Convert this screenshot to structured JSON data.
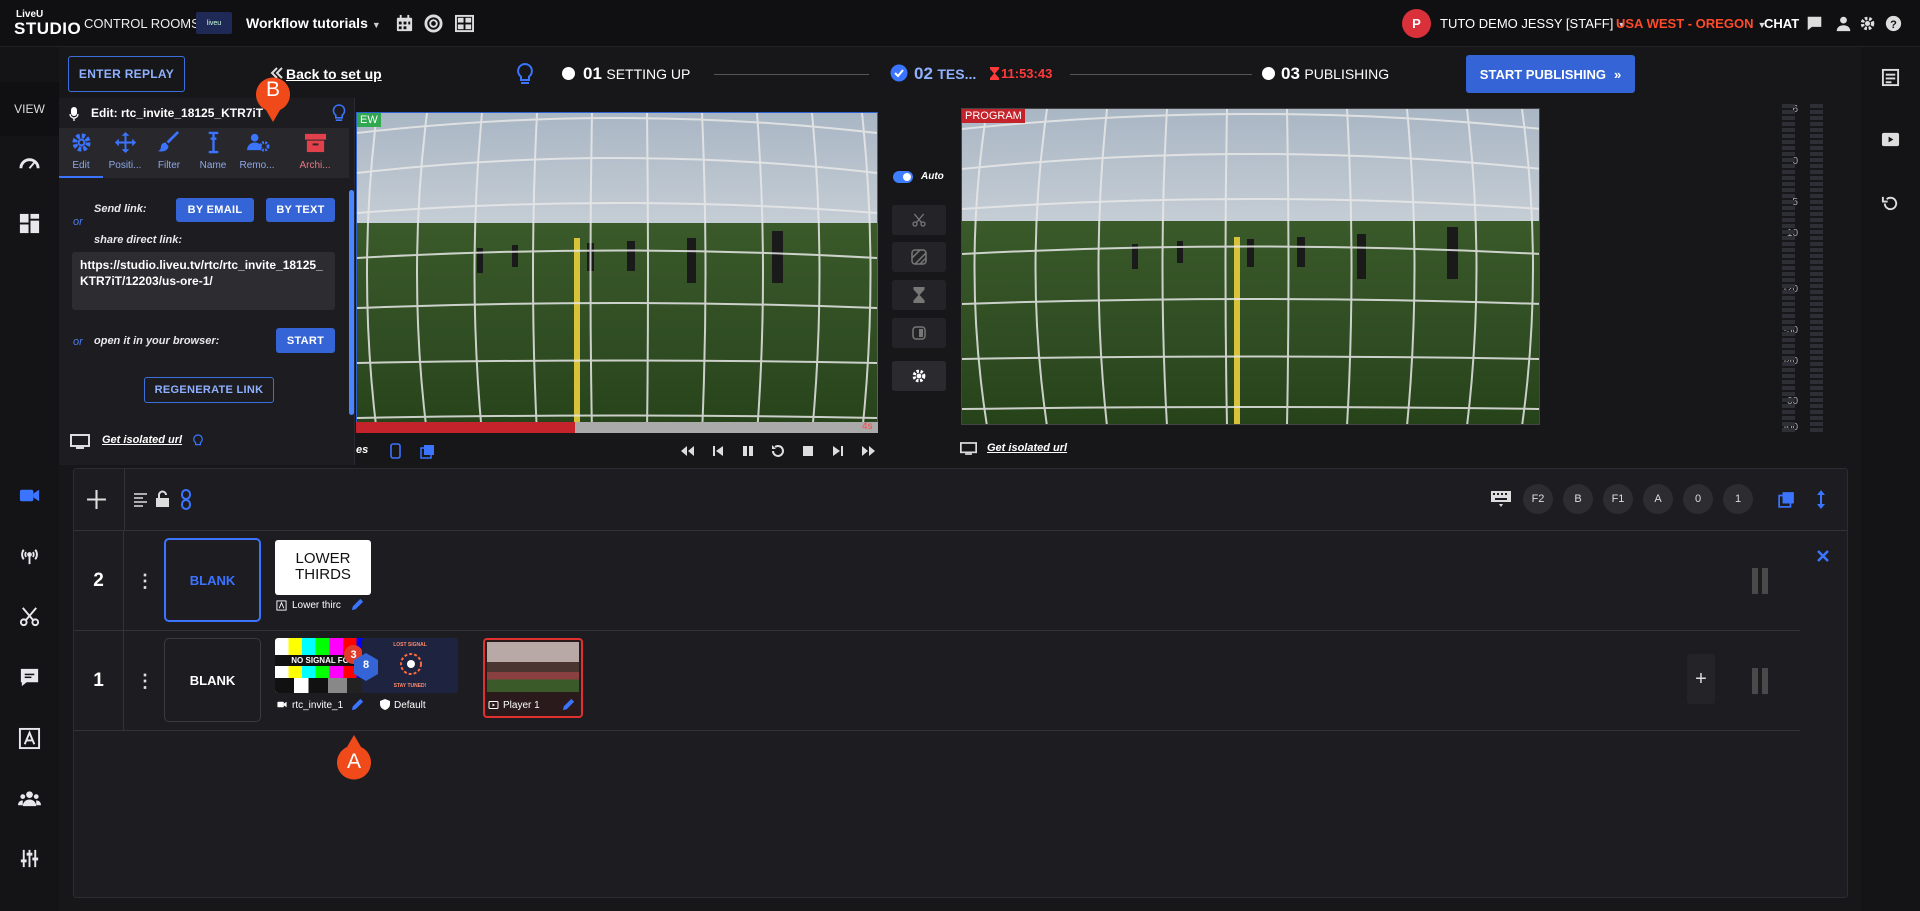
{
  "topbar": {
    "logo_line1": "LiveU",
    "logo_line2": "STUDIO",
    "control_rooms": "CONTROL ROOMS",
    "room_thumb_text": "liveu",
    "room_name": "Workflow tutorials",
    "user_avatar": "P",
    "user_name": "TUTO DEMO JESSY [STAFF]",
    "region": "USA WEST - OREGON",
    "chat": "CHAT"
  },
  "leftnav": {
    "view_label": "VIEW"
  },
  "header": {
    "enter_replay": "ENTER REPLAY",
    "back_to_setup": "Back to set up",
    "steps": [
      {
        "num": "01",
        "label": "SETTING UP"
      },
      {
        "num": "02",
        "label": "TES..."
      },
      {
        "num": "03",
        "label": "PUBLISHING"
      }
    ],
    "timer": "11:53:43",
    "start_publishing": "START PUBLISHING"
  },
  "edit_panel": {
    "title": "Edit: rtc_invite_18125_KTR7iT",
    "tabs": [
      "Edit",
      "Positi...",
      "Filter",
      "Name",
      "Remo...",
      "Archi..."
    ],
    "or1": "or",
    "send_link": "Send link:",
    "by_email": "BY EMAIL",
    "by_text": "BY TEXT",
    "share_direct": "share direct link:",
    "direct_link": "https://studio.liveu.tv/rtc/rtc_invite_18125_KTR7iT/12203/us-ore-1/",
    "or2": "or",
    "open_browser": "open it in your browser:",
    "start": "START",
    "regenerate": "REGENERATE LINK",
    "isolated_url": "Get isolated url"
  },
  "preview": {
    "label": "EW",
    "progress": 0.42,
    "time_left": "4s",
    "bottom_label": "es"
  },
  "program": {
    "label": "PROGRAM",
    "isolated_url": "Get isolated url"
  },
  "mid_controls": {
    "auto_label": "Auto"
  },
  "audio_meter": {
    "scale": [
      "6",
      "0",
      "-5",
      "-10",
      "-20",
      "-30",
      "-40",
      "-60",
      "-00"
    ]
  },
  "layers": {
    "key_badges": [
      "F2",
      "B",
      "F1",
      "A",
      "0",
      "1"
    ],
    "rows": [
      {
        "num": "2",
        "blank": "BLANK",
        "sources": [
          {
            "thumb_line1": "LOWER",
            "thumb_line2": "THIRDS",
            "label": "Lower thirc"
          }
        ]
      },
      {
        "num": "1",
        "blank": "BLANK",
        "sources": [
          {
            "label": "rtc_invite_1",
            "badge": "3",
            "group_count": "8",
            "sub_label": "Default",
            "thumb_text": "NO SIGNAL FOR"
          },
          {
            "label": "Player 1"
          }
        ]
      }
    ],
    "lost_signal_text": "LOST SIGNAL",
    "stay_tuned_text": "STAY TUNED!"
  },
  "markers": {
    "a": "A",
    "b": "B"
  },
  "colors": {
    "accent": "#3564d6",
    "alert": "#ff4a2a",
    "marker": "#f04a1a",
    "program_red": "#c4232b"
  }
}
